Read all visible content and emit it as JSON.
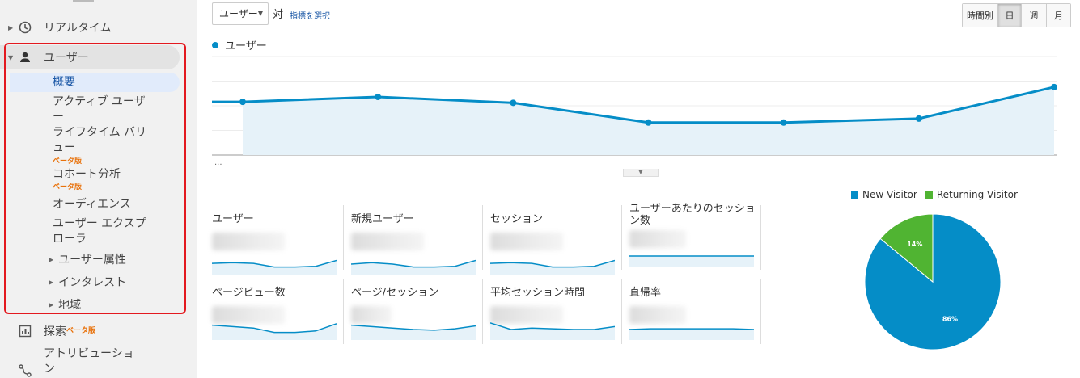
{
  "sidebar": {
    "realtime_label": "リアルタイム",
    "users_label": "ユーザー",
    "sub_items": [
      {
        "label": "概要"
      },
      {
        "label": "アクティブ ユーザ\nー"
      },
      {
        "label": "ライフタイム バリ\nュー",
        "badge": "ベータ版"
      },
      {
        "label": "コホート分析",
        "badge": "ベータ版"
      },
      {
        "label": "オーディエンス"
      },
      {
        "label": "ユーザー エクスプ\nローラ"
      }
    ],
    "collapsible_items": [
      "ユーザー属性",
      "インタレスト",
      "地域"
    ],
    "explore_label": "探索",
    "explore_badge": "ベータ版",
    "attribution_label": "アトリビューショ\nン"
  },
  "toolbar": {
    "metric_dropdown": "ユーザー",
    "vs_label": "対",
    "select_metric_link": "指標を選択",
    "periods": [
      {
        "label": "時間別",
        "selected": false
      },
      {
        "label": "日",
        "selected": true
      },
      {
        "label": "週",
        "selected": false
      },
      {
        "label": "月",
        "selected": false
      }
    ]
  },
  "main_chart": {
    "legend": "ユーザー",
    "color": "#058dc7",
    "ellipsis": "..."
  },
  "chart_data": [
    {
      "type": "line",
      "series": [
        {
          "name": "ユーザー",
          "values": [
            0.54,
            0.59,
            0.53,
            0.33,
            0.33,
            0.37,
            0.69
          ]
        }
      ],
      "ylim": [
        0,
        1
      ]
    },
    {
      "type": "pie",
      "categories": [
        "New Visitor",
        "Returning Visitor"
      ],
      "values": [
        86,
        14
      ],
      "labels": [
        "86%",
        "14%"
      ],
      "colors": [
        "#058dc7",
        "#50b432"
      ]
    }
  ],
  "metrics": [
    {
      "label": "ユーザー",
      "spark": [
        0.55,
        0.6,
        0.55,
        0.3,
        0.3,
        0.35,
        0.75
      ]
    },
    {
      "label": "新規ユーザー",
      "spark": [
        0.5,
        0.6,
        0.5,
        0.3,
        0.3,
        0.35,
        0.75
      ]
    },
    {
      "label": "セッション",
      "spark": [
        0.55,
        0.6,
        0.55,
        0.3,
        0.3,
        0.35,
        0.75
      ]
    },
    {
      "label": "ユーザーあたりのセッション数",
      "spark": [
        0.5,
        0.5,
        0.5,
        0.5,
        0.5,
        0.5,
        0.5
      ]
    },
    {
      "label": "ページビュー数",
      "spark": [
        0.8,
        0.7,
        0.6,
        0.3,
        0.3,
        0.4,
        0.9
      ]
    },
    {
      "label": "ページ/セッション",
      "spark": [
        0.8,
        0.7,
        0.6,
        0.5,
        0.45,
        0.55,
        0.75
      ]
    },
    {
      "label": "平均セッション時間",
      "spark": [
        0.95,
        0.5,
        0.6,
        0.55,
        0.5,
        0.5,
        0.7
      ]
    },
    {
      "label": "直帰率",
      "spark": [
        0.5,
        0.55,
        0.55,
        0.55,
        0.55,
        0.55,
        0.5
      ]
    }
  ],
  "pie_legend": [
    {
      "label": "New Visitor",
      "color": "#058dc7"
    },
    {
      "label": "Returning Visitor",
      "color": "#50b432"
    }
  ]
}
